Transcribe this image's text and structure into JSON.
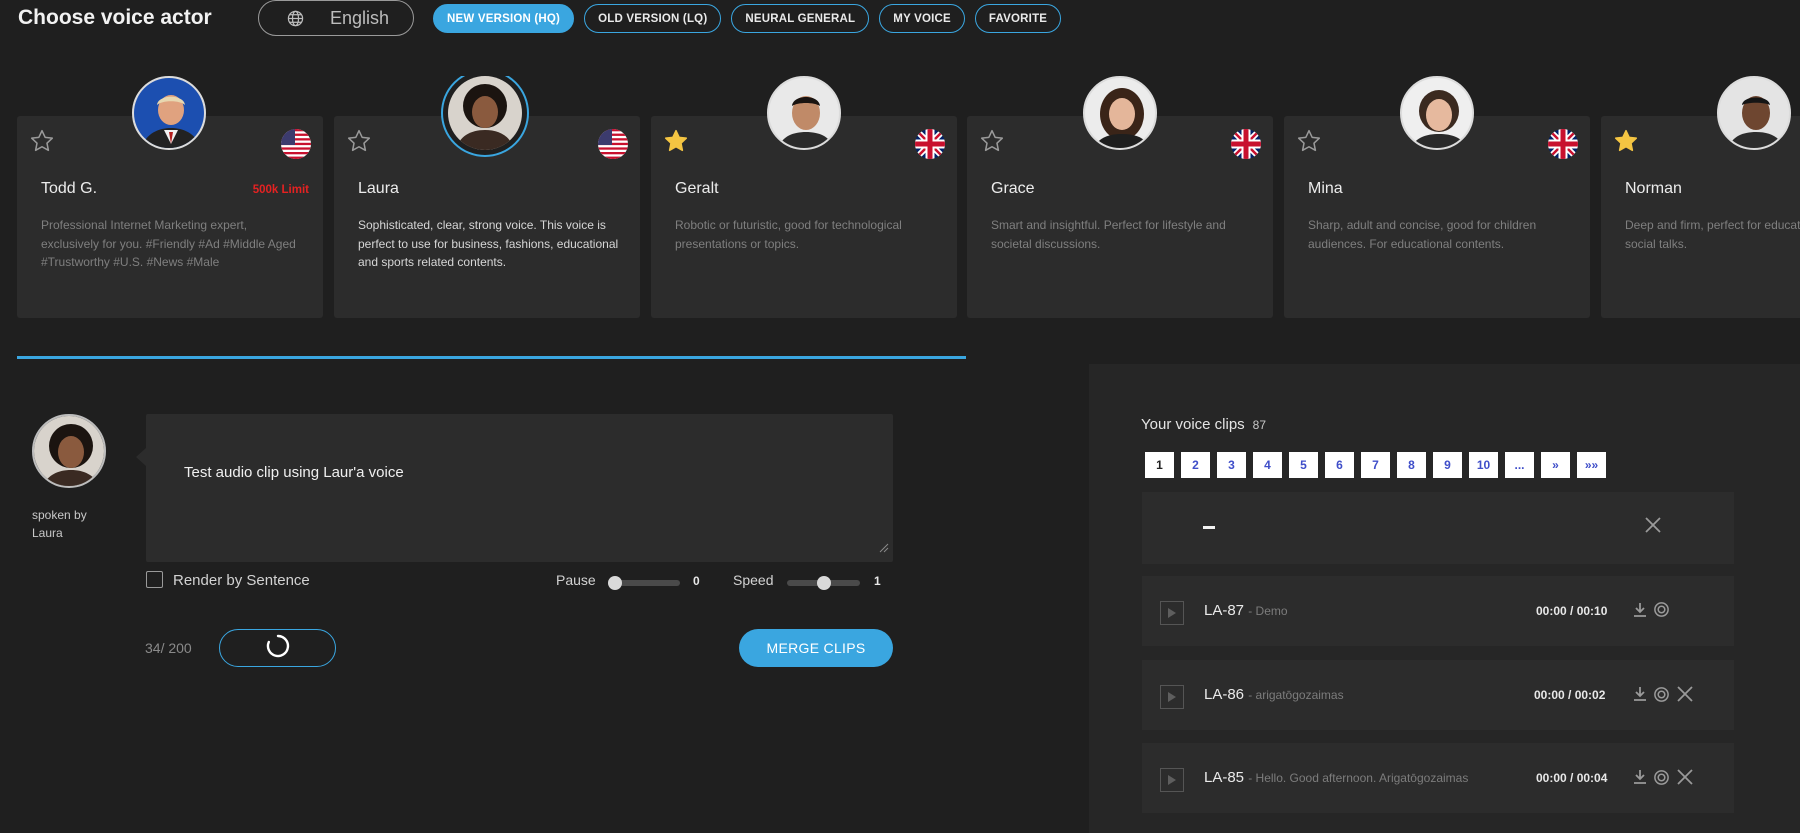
{
  "header": {
    "title": "Choose voice actor",
    "language": "English",
    "filters": [
      {
        "label": "NEW VERSION (HQ)",
        "active": true
      },
      {
        "label": "OLD VERSION (LQ)",
        "active": false
      },
      {
        "label": "NEURAL GENERAL",
        "active": false
      },
      {
        "label": "MY VOICE",
        "active": false
      },
      {
        "label": "FAVORITE",
        "active": false
      }
    ]
  },
  "voices": [
    {
      "name": "Todd G.",
      "limit": "500k Limit",
      "favorite": false,
      "flag": "us-flag",
      "selected": false,
      "desc": "Professional Internet Marketing expert, exclusively for you. #Friendly #Ad #Middle Aged #Trustworthy #U.S. #News #Male"
    },
    {
      "name": "Laura",
      "limit": "",
      "favorite": false,
      "flag": "us-flag",
      "selected": true,
      "desc": "Sophisticated, clear, strong voice. This voice is perfect to use for business, fashions, educational and sports related contents."
    },
    {
      "name": "Geralt",
      "limit": "",
      "favorite": true,
      "flag": "uk-flag",
      "selected": false,
      "desc": "Robotic or futuristic, good for technological presentations or topics."
    },
    {
      "name": "Grace",
      "limit": "",
      "favorite": false,
      "flag": "uk-flag",
      "selected": false,
      "desc": "Smart and insightful. Perfect for lifestyle and societal discussions."
    },
    {
      "name": "Mina",
      "limit": "",
      "favorite": false,
      "flag": "uk-flag",
      "selected": false,
      "desc": "Sharp, adult and concise, good for children audiences. For educational contents."
    },
    {
      "name": "Norman",
      "limit": "",
      "favorite": true,
      "flag": "uk-flag",
      "selected": false,
      "desc": "Deep and firm, perfect for educational topics and social talks."
    }
  ],
  "editor": {
    "spoken_by_label": "spoken by",
    "speaker": "Laura",
    "text": "Test audio clip using Laur'a voice",
    "render_by_sentence_label": "Render by Sentence",
    "pause_label": "Pause",
    "pause_value": "0",
    "pause_level": 0,
    "speed_label": "Speed",
    "speed_value": "1",
    "speed_level": 0.5,
    "char_counter": "34/ 200",
    "merge_label": "MERGE CLIPS"
  },
  "clips": {
    "title": "Your voice clips",
    "count": "87",
    "pages": [
      "1",
      "2",
      "3",
      "4",
      "5",
      "6",
      "7",
      "8",
      "9",
      "10",
      "...",
      "»",
      "»»"
    ],
    "items": [
      {
        "id": "LA-87",
        "desc": "- Demo",
        "time": "00:00 / 00:10",
        "deletable": false
      },
      {
        "id": "LA-86",
        "desc": "- arigatōgozaimas",
        "time": "00:00 / 00:02",
        "deletable": true
      },
      {
        "id": "LA-85",
        "desc": "- Hello. Good afternoon. Arigatōgozaimas",
        "time": "00:00 / 00:04",
        "deletable": true
      }
    ]
  },
  "colors": {
    "accent": "#3aa6e0",
    "limit": "#e52222",
    "background": "#1f1f1f",
    "card": "#2c2c2c"
  }
}
